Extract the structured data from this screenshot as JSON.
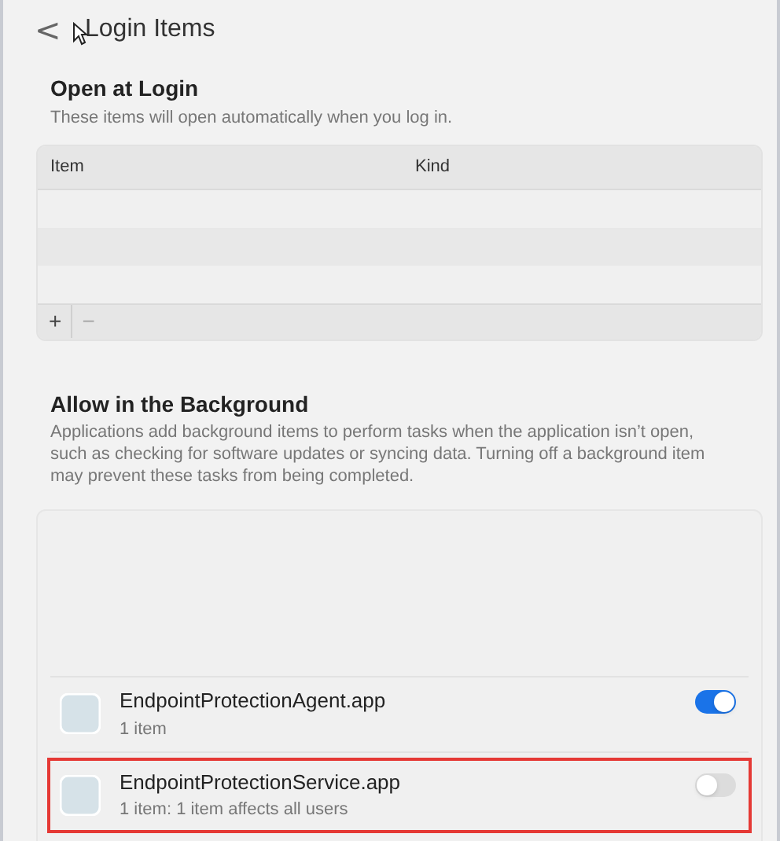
{
  "header": {
    "back": "<",
    "title": "Login Items"
  },
  "open_at_login": {
    "heading": "Open at Login",
    "description": "These items will open automatically when you log in.",
    "table": {
      "columns": [
        "Item",
        "Kind"
      ],
      "footer_buttons": [
        "+",
        "−"
      ]
    }
  },
  "background": {
    "heading": "Allow in the Background",
    "description": "Applications add background items to perform tasks when the application isn’t open, such as checking for software updates or syncing data. Turning off a background item may prevent these tasks from being completed.",
    "items": [
      {
        "name": "EndpointProtectionAgent.app",
        "detail": "1 item",
        "on": true,
        "highlighted": false
      },
      {
        "name": "EndpointProtectionService.app",
        "detail": "1 item: 1 item affects all users",
        "on": false,
        "highlighted": true
      }
    ]
  }
}
